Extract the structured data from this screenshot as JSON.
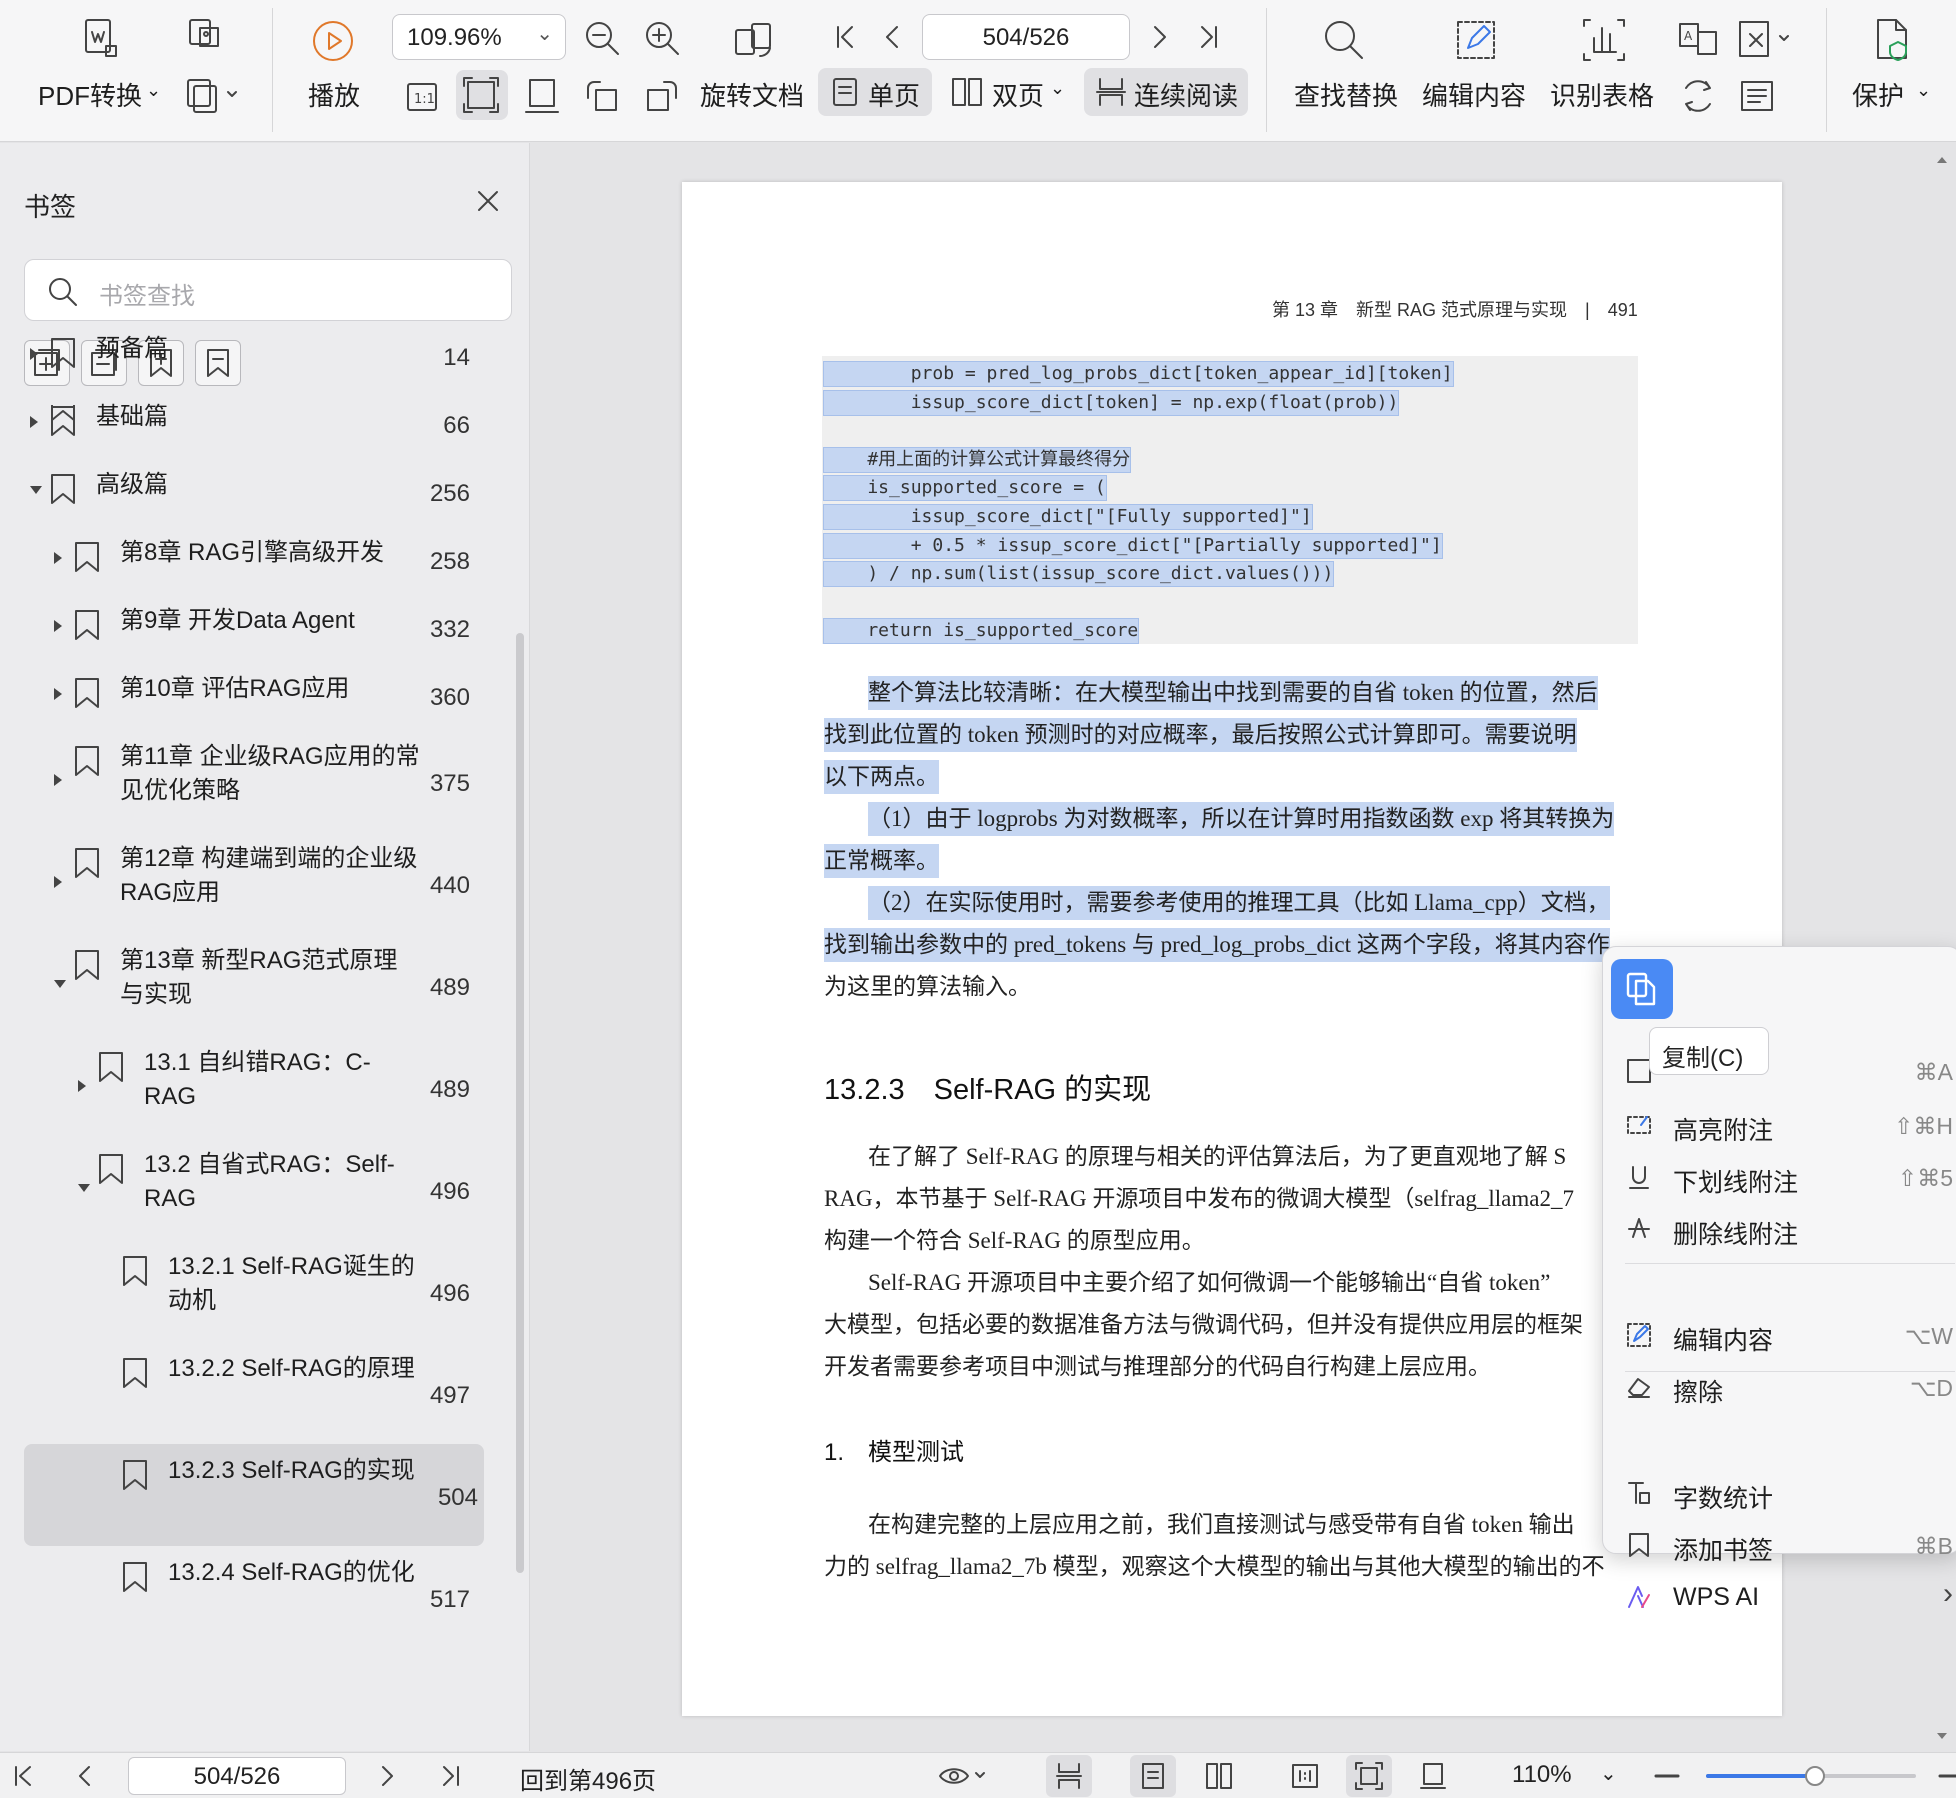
{
  "toolbar": {
    "pdf_convert": "PDF转换",
    "play": "播放",
    "zoom": "109.96%",
    "rotate_doc": "旋转文档",
    "page_indicator": "504/526",
    "single_page": "单页",
    "double_page": "双页",
    "continuous": "连续阅读",
    "find_replace": "查找替换",
    "edit_content": "编辑内容",
    "recognize_table": "识别表格",
    "protect": "保护",
    "icons": [
      "pdf-convert-icon",
      "export-icon",
      "play-icon",
      "zoom-out-icon",
      "zoom-in-icon",
      "rotate-icon",
      "first-page-icon",
      "prev-page-icon",
      "next-page-icon",
      "last-page-icon",
      "search-icon",
      "edit-icon",
      "table-icon",
      "translate-icon",
      "protect-icon"
    ]
  },
  "sidebar": {
    "title": "书签",
    "search_placeholder": "书签查找",
    "items": [
      {
        "label": "预备篇",
        "page": "14"
      },
      {
        "label": "基础篇",
        "page": "66"
      },
      {
        "label": "高级篇",
        "page": "256"
      },
      {
        "label": "第8章 RAG引擎高级开发",
        "page": "258"
      },
      {
        "label": "第9章 开发Data Agent",
        "page": "332"
      },
      {
        "label": "第10章 评估RAG应用",
        "page": "360"
      },
      {
        "label": "第11章 企业级RAG应用的常见优化策略",
        "page": "375"
      },
      {
        "label": "第12章 构建端到端的企业级RAG应用",
        "page": "440"
      },
      {
        "label": "第13章 新型RAG范式原理与实现",
        "page": "489"
      },
      {
        "label": "13.1 自纠错RAG：C-RAG",
        "page": "489"
      },
      {
        "label": "13.2 自省式RAG：Self-RAG",
        "page": "496"
      },
      {
        "label": "13.2.1 Self-RAG诞生的动机",
        "page": "496"
      },
      {
        "label": "13.2.2 Self-RAG的原理",
        "page": "497"
      },
      {
        "label": "13.2.3 Self-RAG的实现",
        "page": "504"
      },
      {
        "label": "13.2.4 Self-RAG的优化",
        "page": "517"
      }
    ]
  },
  "document": {
    "header": "第 13 章　新型 RAG 范式原理与实现　|　491",
    "code_lines": [
      "        prob = pred_log_probs_dict[token_appear_id][token]",
      "        issup_score_dict[token] = np.exp(float(prob))",
      "",
      "    #用上面的计算公式计算最终得分",
      "    is_supported_score = (",
      "        issup_score_dict[\"[Fully supported]\"]",
      "        + 0.5 * issup_score_dict[\"[Partially supported]\"]",
      "    ) / np.sum(list(issup_score_dict.values()))",
      "",
      "    return is_supported_score"
    ],
    "para1": [
      "整个算法比较清晰：在大模型输出中找到需要的自省 token 的位置，然后",
      "找到此位置的 token 预测时的对应概率，最后按照公式计算即可。需要说明",
      "以下两点。"
    ],
    "para2": [
      "（1）由于 logprobs 为对数概率，所以在计算时用指数函数 exp 将其转换为",
      "正常概率。"
    ],
    "para3": [
      "（2）在实际使用时，需要参考使用的推理工具（比如 Llama_cpp）文档，",
      "找到输出参数中的 pred_tokens 与 pred_log_probs_dict 这两个字段，将其内容作",
      "为这里的算法输入。"
    ],
    "section_title": "13.2.3　Self-RAG 的实现",
    "para4": [
      "在了解了 Self-RAG 的原理与相关的评估算法后，为了更直观地了解 S",
      "RAG，本节基于 Self-RAG 开源项目中发布的微调大模型（selfrag_llama2_7",
      "构建一个符合 Self-RAG 的原型应用。"
    ],
    "para5": [
      "Self-RAG 开源项目中主要介绍了如何微调一个能够输出“自省 token”",
      "大模型，包括必要的数据准备方法与微调代码，但并没有提供应用层的框架",
      "开发者需要参考项目中测试与推理部分的代码自行构建上层应用。"
    ],
    "subsection_title": "1.　模型测试",
    "para6": [
      "在构建完整的上层应用之前，我们直接测试与感受带有自省 token 输出",
      "力的 selfrag_llama2_7b 模型，观察这个大模型的输出与其他大模型的输出的不"
    ]
  },
  "context_menu": {
    "tooltip": "复制(C)",
    "select_all_shortcut": "⌘A",
    "items": [
      {
        "label": "高亮附注",
        "shortcut": "⇧⌘H"
      },
      {
        "label": "下划线附注",
        "shortcut": "⇧⌘5"
      },
      {
        "label": "删除线附注",
        "shortcut": ""
      },
      {
        "label": "编辑内容",
        "shortcut": "⌥W"
      },
      {
        "label": "擦除",
        "shortcut": "⌥D"
      },
      {
        "label": "字数统计",
        "shortcut": ""
      },
      {
        "label": "添加书签",
        "shortcut": "⌘B"
      },
      {
        "label": "WPS AI",
        "shortcut": "›"
      }
    ]
  },
  "bottom_bar": {
    "page_indicator": "504/526",
    "back_to": "回到第496页",
    "zoom": "110%",
    "zoom_level": 0.52
  },
  "colors": {
    "accent": "#4a8af4",
    "selection": "#c5d6f2"
  }
}
